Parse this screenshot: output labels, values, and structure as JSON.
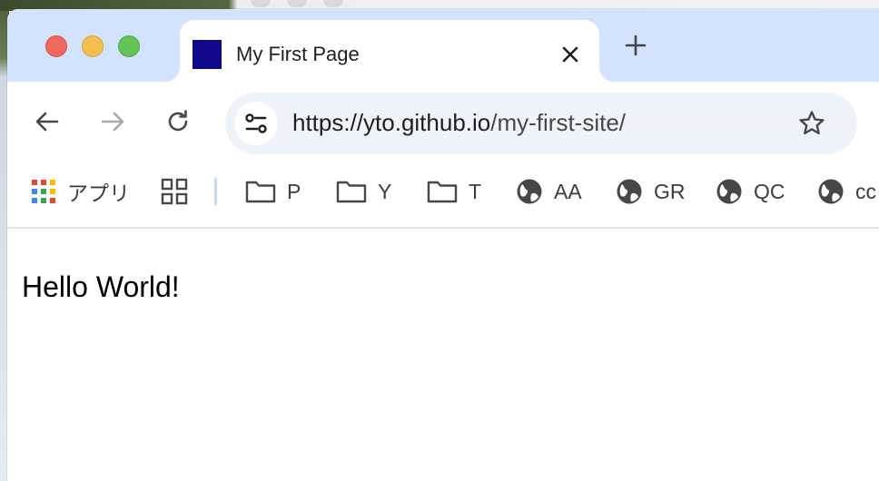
{
  "tab": {
    "title": "My First Page",
    "favicon_color": "#100a8a"
  },
  "toolbar": {
    "url_host": "https://yto.github.io",
    "url_path": "/my-first-site/"
  },
  "bookmarks": {
    "apps_label": "アプリ",
    "items": [
      {
        "label": "P",
        "icon": "folder-icon"
      },
      {
        "label": "Y",
        "icon": "folder-icon"
      },
      {
        "label": "T",
        "icon": "folder-icon"
      },
      {
        "label": "AA",
        "icon": "globe-icon"
      },
      {
        "label": "GR",
        "icon": "globe-icon"
      },
      {
        "label": "QC",
        "icon": "globe-icon"
      },
      {
        "label": "cc",
        "icon": "globe-icon"
      }
    ]
  },
  "page": {
    "text": "Hello World!"
  },
  "colors": {
    "tabstrip": "#d3e3fd",
    "omnibox": "#eef2f9",
    "close": "#ee6a5e",
    "minimize": "#f5bf4f",
    "zoom": "#61c454"
  }
}
